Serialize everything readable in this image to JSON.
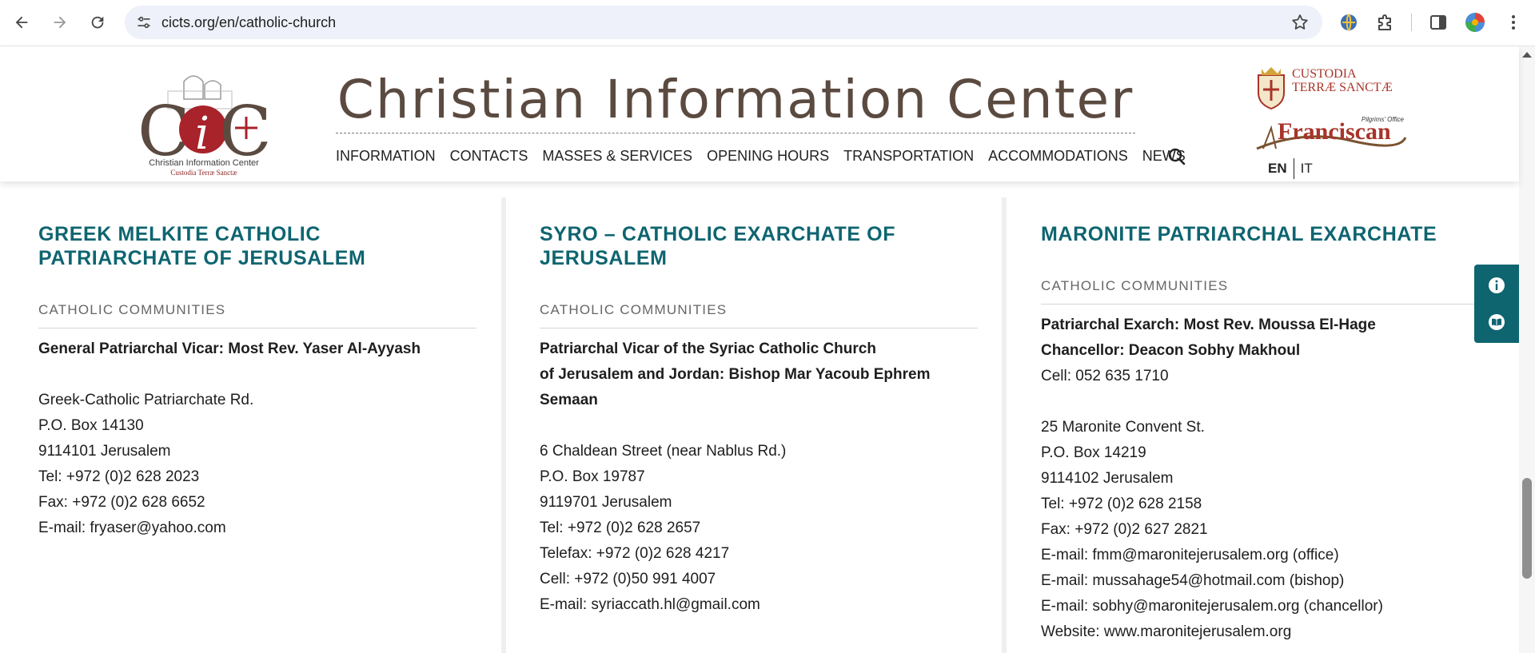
{
  "browser": {
    "url": "cicts.org/en/catholic-church"
  },
  "header": {
    "title": "Christian Information Center",
    "logo_caption": "Christian Information Center",
    "logo_subcaption": "Custodia Terræ Sanctæ",
    "logo_letters": "CiC",
    "custodia_line1": "CUSTODIA",
    "custodia_line2": "TERRÆ SANCTÆ",
    "franciscan_label": "Franciscan",
    "pilgrims_office": "Pilgrims' Office",
    "nav": [
      "INFORMATION",
      "CONTACTS",
      "MASSES & SERVICES",
      "OPENING HOURS",
      "TRANSPORTATION",
      "ACCOMMODATIONS",
      "NEWS"
    ],
    "lang_en": "EN",
    "lang_it": "IT"
  },
  "columns": [
    {
      "title": "GREEK MELKITE CATHOLIC PATRIARCHATE OF JERUSALEM",
      "category": "CATHOLIC COMMUNITIES",
      "bold_lines": [
        "General Patriarchal Vicar: Most Rev. Yaser Al-Ayyash"
      ],
      "pre_gap_lines": [],
      "lines": [
        "Greek-Catholic Patriarchate Rd.",
        "P.O. Box 14130",
        "9114101 Jerusalem",
        "Tel: +972 (0)2 628 2023",
        "Fax: +972 (0)2 628 6652",
        "E-mail: fryaser@yahoo.com"
      ]
    },
    {
      "title": "SYRO – CATHOLIC EXARCHATE OF JERUSALEM",
      "category": "CATHOLIC COMMUNITIES",
      "bold_lines": [
        "Patriarchal Vicar of the Syriac Catholic Church",
        "of Jerusalem and Jordan: Bishop Mar Yacoub Ephrem Semaan"
      ],
      "pre_gap_lines": [],
      "lines": [
        "6 Chaldean Street (near Nablus Rd.)",
        "P.O. Box 19787",
        "9119701 Jerusalem",
        "Tel: +972 (0)2 628 2657",
        "Telefax: +972 (0)2 628 4217",
        "Cell: +972 (0)50 991 4007",
        "E-mail: syriaccath.hl@gmail.com"
      ]
    },
    {
      "title": "MARONITE PATRIARCHAL EXARCHATE",
      "category": "CATHOLIC COMMUNITIES",
      "bold_lines": [
        "Patriarchal Exarch: Most Rev. Moussa El-Hage",
        "Chancellor: Deacon Sobhy Makhoul"
      ],
      "pre_gap_lines": [
        "Cell: 052 635 1710"
      ],
      "lines": [
        "25 Maronite Convent St.",
        "P.O. Box 14219",
        "9114102  Jerusalem",
        "Tel: +972 (0)2 628 2158",
        "Fax: +972 (0)2 627 2821",
        "E-mail: fmm@maronitejerusalem.org (office)",
        "E-mail: mussahage54@hotmail.com (bishop)",
        "E-mail: sobhy@maronitejerusalem.org (chancellor)",
        "Website: www.maronitejerusalem.org"
      ]
    }
  ],
  "colors": {
    "heading": "#0e6570",
    "title": "#5b4a40",
    "side_tab": "#0e6570",
    "custodia": "#a8342a"
  },
  "icons": {
    "back": "arrow-left-icon",
    "forward": "arrow-right-icon",
    "reload": "reload-icon",
    "site_info": "tune-icon",
    "bookmark": "star-icon",
    "search": "search-icon",
    "info": "info-icon",
    "book": "book-icon"
  }
}
